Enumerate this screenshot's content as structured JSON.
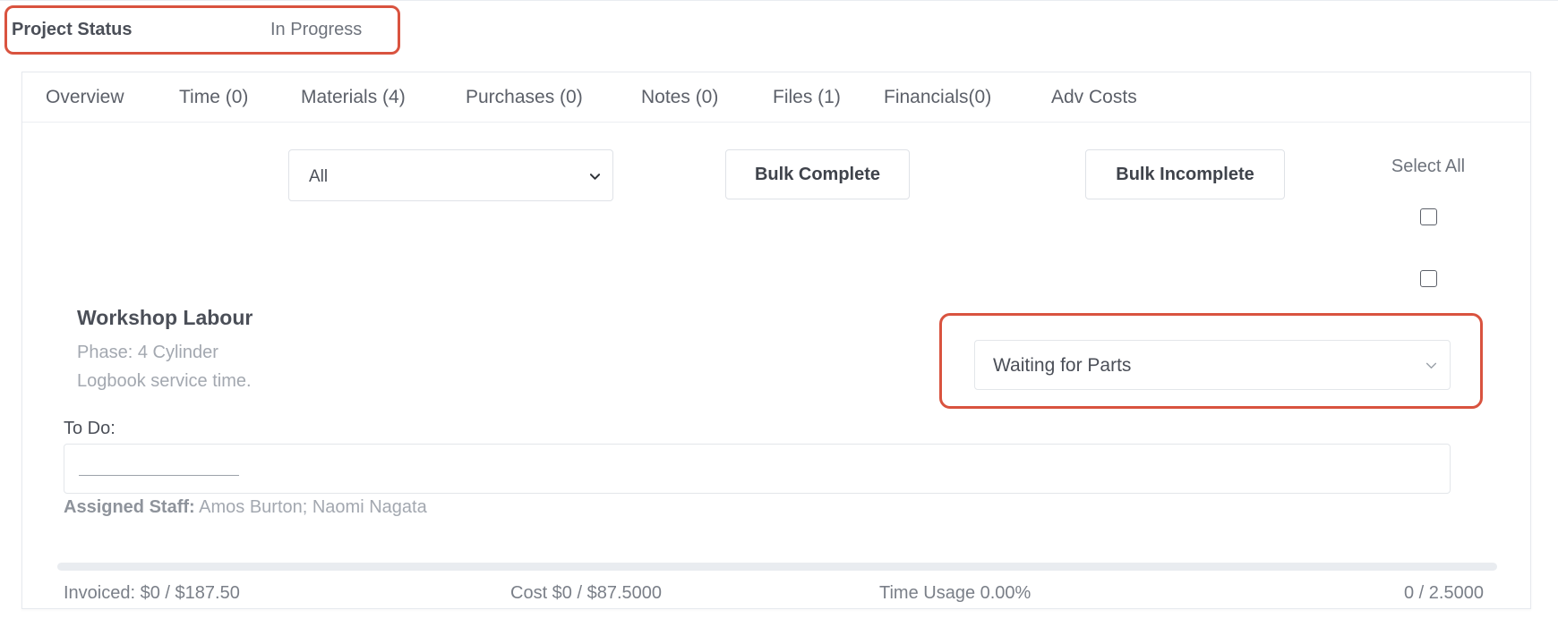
{
  "project_status": {
    "label": "Project Status",
    "value": "In Progress"
  },
  "tabs": [
    {
      "label": "Overview"
    },
    {
      "label": "Time (0)"
    },
    {
      "label": "Materials (4)"
    },
    {
      "label": "Purchases (0)"
    },
    {
      "label": "Notes (0)"
    },
    {
      "label": "Files (1)"
    },
    {
      "label": "Financials(0)"
    },
    {
      "label": "Adv Costs"
    }
  ],
  "toolbar": {
    "filter_value": "All",
    "bulk_complete_label": "Bulk Complete",
    "bulk_incomplete_label": "Bulk Incomplete",
    "select_all_label": "Select All",
    "select_all_checked": false
  },
  "item": {
    "checked": false,
    "title": "Workshop Labour",
    "phase": "Phase: 4 Cylinder",
    "description": "Logbook service time.",
    "status_value": "Waiting for Parts",
    "todo_label": "To Do:",
    "assigned_label": "Assigned Staff:",
    "assigned_staff": "Amos Burton; Naomi Nagata",
    "time_usage_fraction": 0.0
  },
  "footer": {
    "invoiced": "Invoiced: $0 / $187.50",
    "cost": "Cost $0 / $87.5000",
    "time_usage": "Time Usage 0.00%",
    "hours": "0 / 2.5000"
  },
  "colors": {
    "highlight": "#d9533f",
    "progress": "#5a8dee"
  }
}
